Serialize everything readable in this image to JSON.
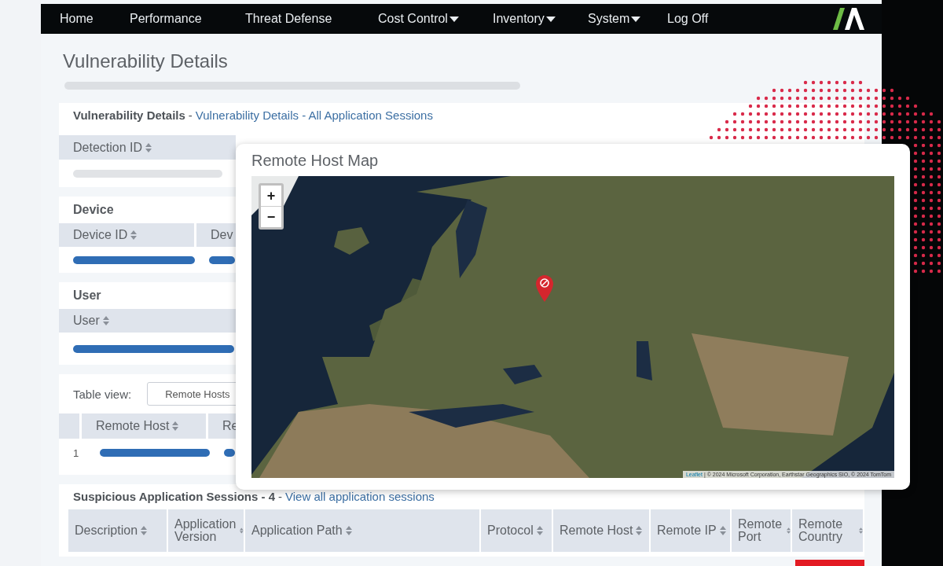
{
  "nav": {
    "items": [
      {
        "label": "Home",
        "dropdown": false
      },
      {
        "label": "Performance",
        "dropdown": false
      },
      {
        "label": "Threat Defense",
        "dropdown": false
      },
      {
        "label": "Cost Control",
        "dropdown": true
      },
      {
        "label": "Inventory",
        "dropdown": true
      },
      {
        "label": "System",
        "dropdown": true
      },
      {
        "label": "Log Off",
        "dropdown": false
      }
    ]
  },
  "page_title": "Vulnerability Details",
  "details": {
    "title": "Vulnerability Details",
    "separator": "-",
    "link": "Vulnerability Details - All Application Sessions",
    "columns": [
      "Detection ID"
    ]
  },
  "device": {
    "title": "Device",
    "columns": [
      "Device ID",
      "Dev"
    ]
  },
  "user": {
    "title": "User",
    "columns": [
      "User"
    ]
  },
  "table_view": {
    "label": "Table view:",
    "button": "Remote Hosts",
    "columns": [
      "Remote Host",
      "Re"
    ],
    "rows": [
      {
        "index": "1"
      }
    ]
  },
  "map": {
    "title": "Remote Host Map",
    "zoom_in": "+",
    "zoom_out": "−",
    "attribution_link": "Leaflet",
    "attribution": "| © 2024 Microsoft Corporation, Earthstar Geographics SIO, © 2024 TomTom"
  },
  "sessions": {
    "title": "Suspicious Application Sessions - 4",
    "separator": "-",
    "link": "View all application sessions",
    "columns": [
      "Description",
      "Application Version",
      "Application Path",
      "Protocol",
      "Remote Host",
      "Remote IP",
      "Remote Port",
      "Remote Country"
    ]
  }
}
